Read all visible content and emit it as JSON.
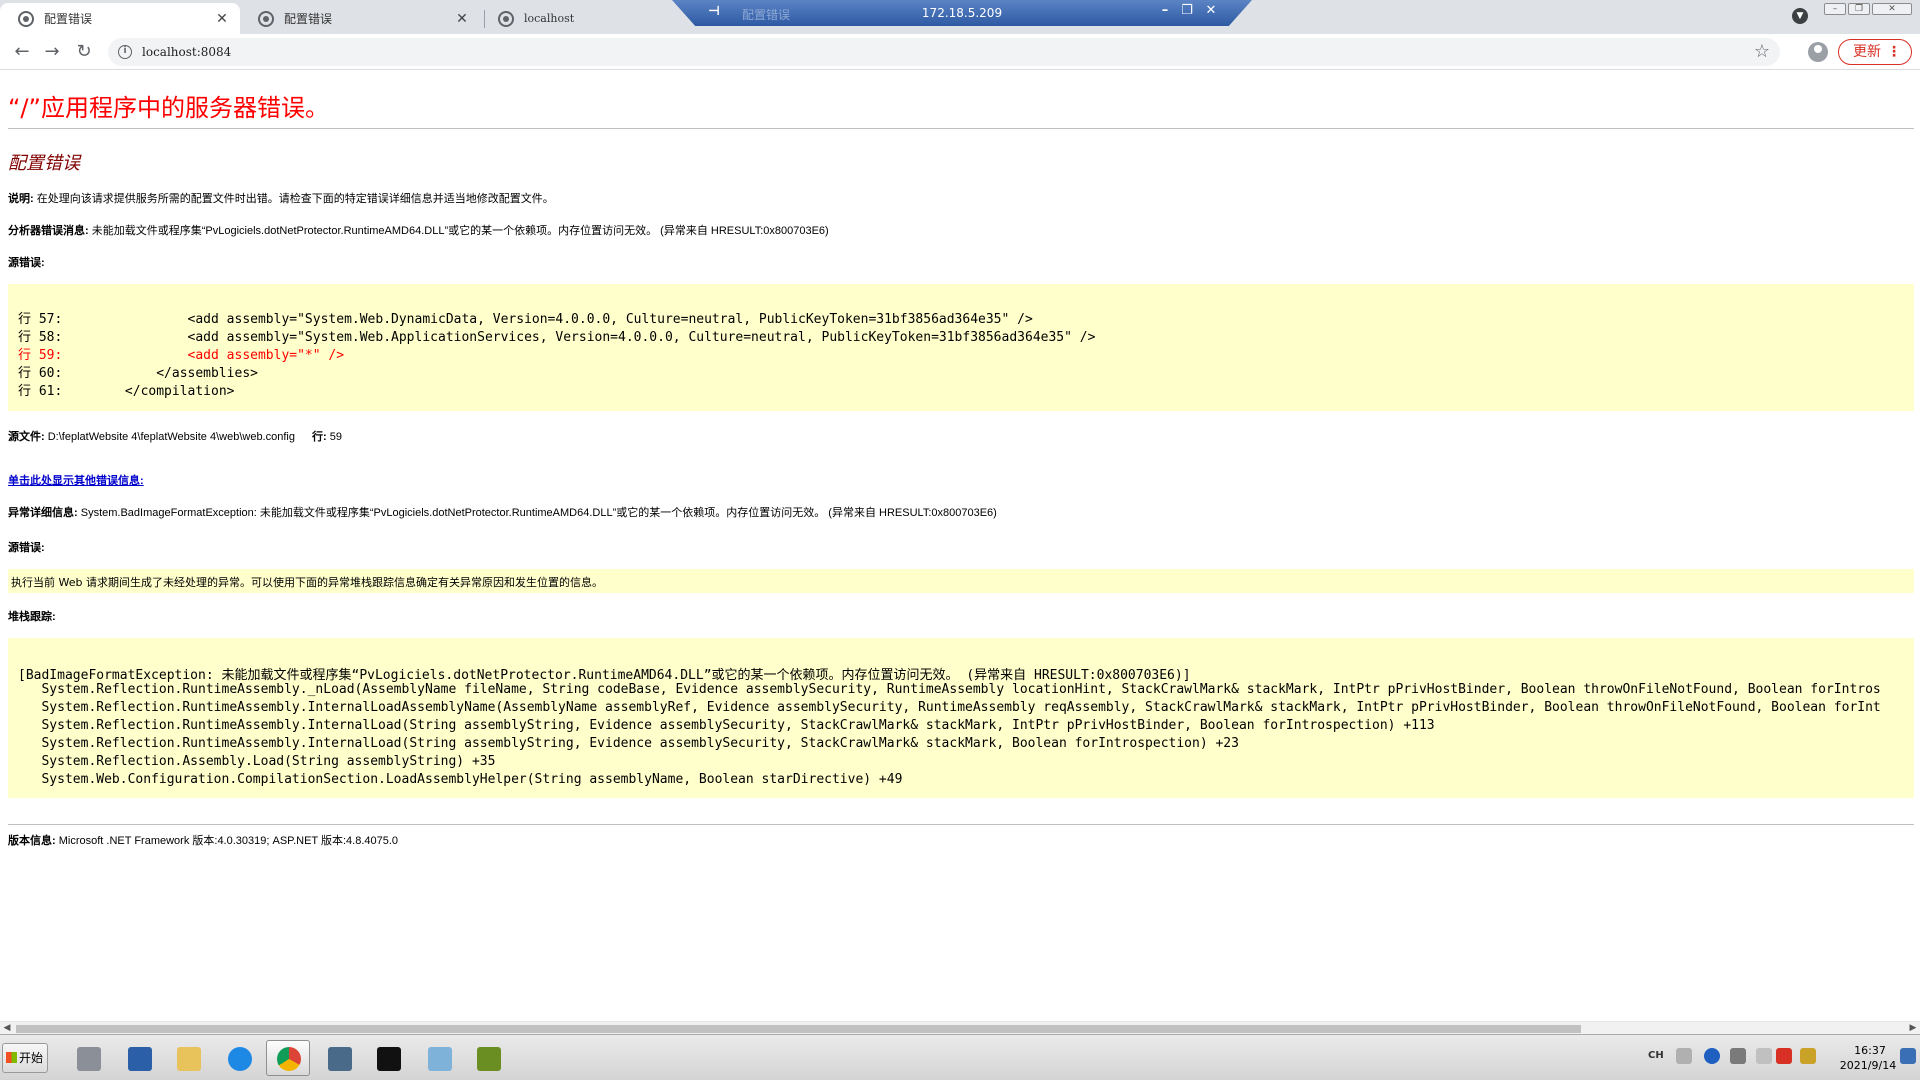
{
  "browser": {
    "tabs": [
      {
        "title": "配置错误"
      },
      {
        "title": "配置错误"
      },
      {
        "title": "localhost"
      }
    ],
    "remote_bar": {
      "ip": "172.18.5.209",
      "ghost_title": "配置错误"
    },
    "address": "localhost:8084",
    "update_label": "更新"
  },
  "page": {
    "title": "“/”应用程序中的服务器错误。",
    "error_heading": "配置错误",
    "description_label": "说明:",
    "description": "在处理向该请求提供服务所需的配置文件时出错。请检查下面的特定错误详细信息并适当地修改配置文件。",
    "parser_label": "分析器错误消息:",
    "parser_message": "未能加载文件或程序集“PvLogiciels.dotNetProtector.RuntimeAMD64.DLL”或它的某一个依赖项。内存位置访问无效。 (异常来自 HRESULT:0x800703E6)",
    "source_error_label": "源错误:",
    "code_lines": [
      {
        "text": "行 57:                <add assembly=\"System.Web.DynamicData, Version=4.0.0.0, Culture=neutral, PublicKeyToken=31bf3856ad364e35\" />",
        "highlight": false
      },
      {
        "text": "行 58:                <add assembly=\"System.Web.ApplicationServices, Version=4.0.0.0, Culture=neutral, PublicKeyToken=31bf3856ad364e35\" />",
        "highlight": false
      },
      {
        "text": "行 59:                <add assembly=\"*\" />",
        "highlight": true
      },
      {
        "text": "行 60:            </assemblies>",
        "highlight": false
      },
      {
        "text": "行 61:        </compilation>",
        "highlight": false
      }
    ],
    "source_file_label": "源文件:",
    "source_file": "D:\\feplatWebsite 4\\feplatWebsite 4\\web\\web.config",
    "line_label": "行:",
    "line_number": "59",
    "more_link": "单击此处显示其他错误信息:",
    "exception_label": "异常详细信息:",
    "exception_details": "System.BadImageFormatException: 未能加载文件或程序集“PvLogiciels.dotNetProtector.RuntimeAMD64.DLL”或它的某一个依赖项。内存位置访问无效。 (异常来自 HRESULT:0x800703E6)",
    "source_error_label2": "源错误:",
    "unhandled_message": "执行当前 Web 请求期间生成了未经处理的异常。可以使用下面的异常堆栈跟踪信息确定有关异常原因和发生位置的信息。",
    "stack_trace_label": "堆栈跟踪:",
    "stack_lines": [
      "[BadImageFormatException: 未能加载文件或程序集“PvLogiciels.dotNetProtector.RuntimeAMD64.DLL”或它的某一个依赖项。内存位置访问无效。 (异常来自 HRESULT:0x800703E6)]",
      "   System.Reflection.RuntimeAssembly._nLoad(AssemblyName fileName, String codeBase, Evidence assemblySecurity, RuntimeAssembly locationHint, StackCrawlMark& stackMark, IntPtr pPrivHostBinder, Boolean throwOnFileNotFound, Boolean forIntros",
      "   System.Reflection.RuntimeAssembly.InternalLoadAssemblyName(AssemblyName assemblyRef, Evidence assemblySecurity, RuntimeAssembly reqAssembly, StackCrawlMark& stackMark, IntPtr pPrivHostBinder, Boolean throwOnFileNotFound, Boolean forInt",
      "   System.Reflection.RuntimeAssembly.InternalLoad(String assemblyString, Evidence assemblySecurity, StackCrawlMark& stackMark, IntPtr pPrivHostBinder, Boolean forIntrospection) +113",
      "   System.Reflection.RuntimeAssembly.InternalLoad(String assemblyString, Evidence assemblySecurity, StackCrawlMark& stackMark, Boolean forIntrospection) +23",
      "   System.Reflection.Assembly.Load(String assemblyString) +35",
      "   System.Web.Configuration.CompilationSection.LoadAssemblyHelper(String assemblyName, Boolean starDirective) +49"
    ],
    "version_label": "版本信息:",
    "version_info": "Microsoft .NET Framework 版本:4.0.30319; ASP.NET 版本:4.8.4075.0"
  },
  "taskbar": {
    "start_label": "开始",
    "apps": [
      {
        "name": "server-manager-icon",
        "color": "#8a8f98"
      },
      {
        "name": "powershell-icon",
        "color": "#2b5fa8"
      },
      {
        "name": "file-explorer-icon",
        "color": "#e8c25a"
      },
      {
        "name": "browser-blue-icon",
        "color": "#1e88e5"
      },
      {
        "name": "chrome-icon",
        "color": "#db4437"
      },
      {
        "name": "app-window-icon",
        "color": "#4a6a8a"
      },
      {
        "name": "command-prompt-icon",
        "color": "#111111"
      },
      {
        "name": "notepad-icon",
        "color": "#7fb2d9"
      },
      {
        "name": "network-app-icon",
        "color": "#6b8e23"
      }
    ],
    "lang": "CH",
    "time": "16:37",
    "date": "2021/9/14"
  }
}
